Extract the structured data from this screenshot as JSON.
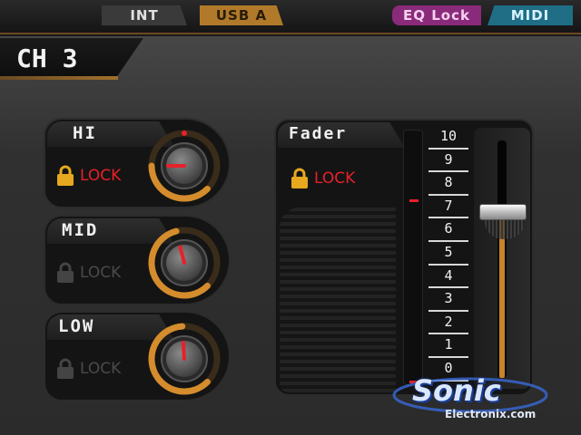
{
  "topbar": {
    "int_label": "INT",
    "usb_label": "USB A",
    "eq_lock_label": "EQ Lock",
    "midi_label": "MIDI"
  },
  "channel": {
    "label": "CH 3"
  },
  "eq_bands": [
    {
      "label": "HI",
      "lock_label": "LOCK",
      "locked": true,
      "knob_level": 0.5
    },
    {
      "label": "MID",
      "lock_label": "LOCK",
      "locked": false,
      "knob_level": 0.78
    },
    {
      "label": "LOW",
      "lock_label": "LOCK",
      "locked": false,
      "knob_level": 0.82
    }
  ],
  "fader": {
    "label": "Fader",
    "lock_label": "LOCK",
    "locked": true,
    "scale": [
      "10",
      "9",
      "8",
      "7",
      "6",
      "5",
      "4",
      "3",
      "2",
      "1",
      "0"
    ],
    "level": 0.7
  },
  "watermark": {
    "brand": "Sonic",
    "sub": "Electronix.com"
  },
  "colors": {
    "accent_orange": "#c8842c",
    "lock_red": "#e8202a",
    "eq_lock_purple": "#8a2a7a",
    "midi_teal": "#1f6e86",
    "usb_gold": "#b07a2a"
  }
}
